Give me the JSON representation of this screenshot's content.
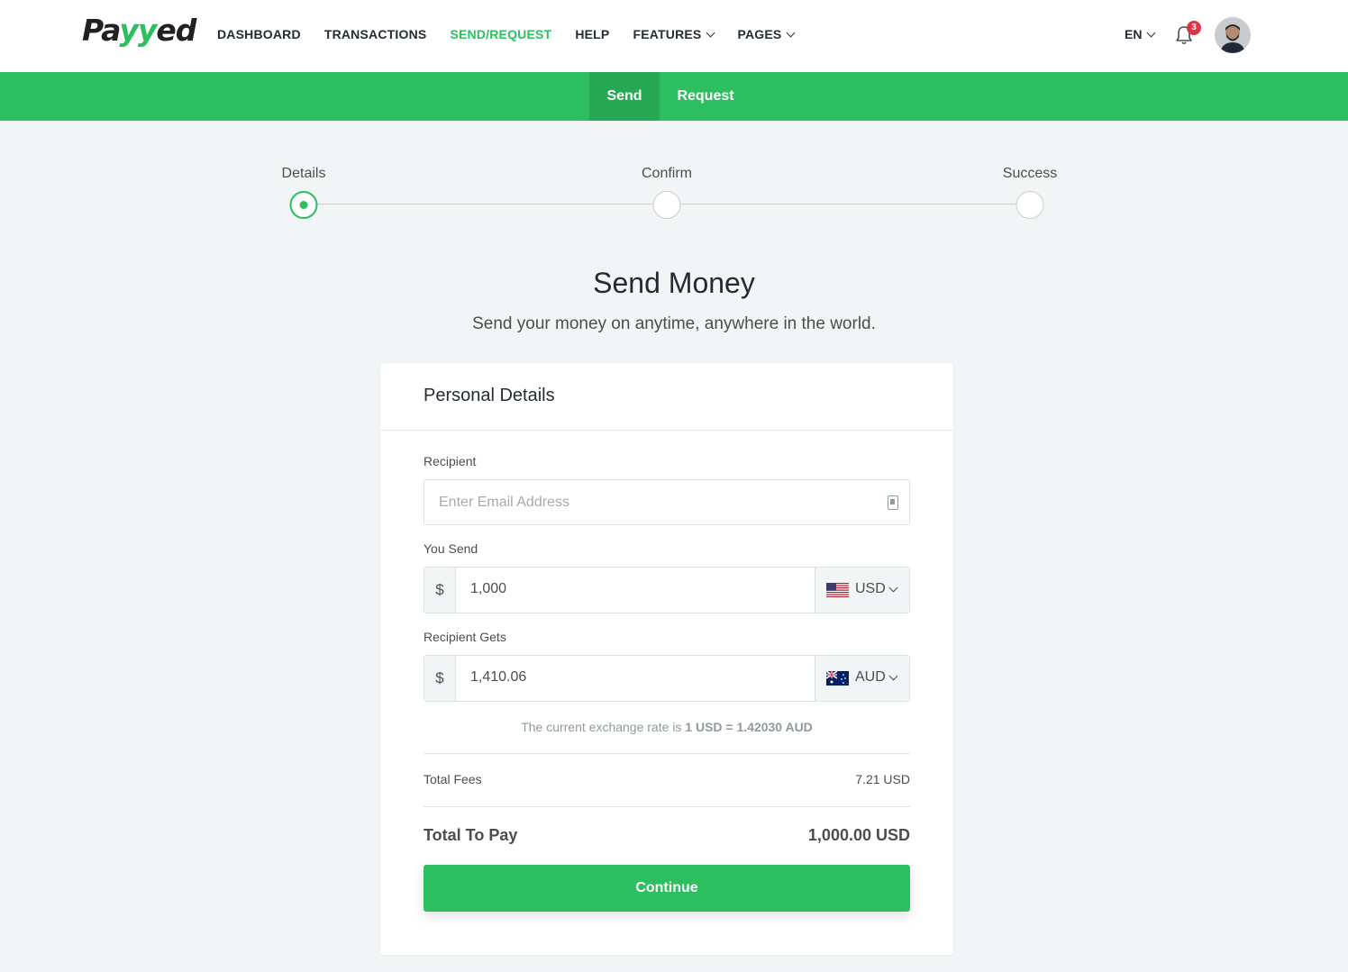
{
  "brand": {
    "logo_left": "Pa",
    "logo_green": "yy",
    "logo_right": "ed",
    "accent": "#2dbe60"
  },
  "nav": {
    "items": [
      {
        "label": "DASHBOARD"
      },
      {
        "label": "TRANSACTIONS"
      },
      {
        "label": "SEND/REQUEST",
        "active": true
      },
      {
        "label": "HELP"
      },
      {
        "label": "FEATURES",
        "dropdown": true
      },
      {
        "label": "PAGES",
        "dropdown": true
      }
    ],
    "lang": "EN",
    "notification_count": "3",
    "icons": {
      "bell": "bell-icon",
      "avatar": "user-avatar"
    }
  },
  "subnav": {
    "tabs": [
      {
        "label": "Send",
        "active": true
      },
      {
        "label": "Request"
      }
    ]
  },
  "stepper": {
    "steps": [
      {
        "label": "Details",
        "state": "active"
      },
      {
        "label": "Confirm"
      },
      {
        "label": "Success"
      }
    ]
  },
  "page": {
    "title": "Send Money",
    "subtitle": "Send your money on anytime, anywhere in the world."
  },
  "form": {
    "card_title": "Personal Details",
    "recipient_label": "Recipient",
    "recipient_placeholder": "Enter Email Address",
    "you_send_label": "You Send",
    "you_send_prefix": "$",
    "you_send_value": "1,000",
    "you_send_currency": "USD",
    "recipient_gets_label": "Recipient Gets",
    "recipient_gets_prefix": "$",
    "recipient_gets_value": "1,410.06",
    "recipient_gets_currency": "AUD",
    "rate_text": "The current exchange rate is",
    "rate_value": "1 USD = 1.42030 AUD",
    "total_fees_label": "Total Fees",
    "total_fees_value": "7.21 USD",
    "total_to_pay_label": "Total To Pay",
    "total_to_pay_value": "1,000.00 USD",
    "continue_label": "Continue"
  }
}
